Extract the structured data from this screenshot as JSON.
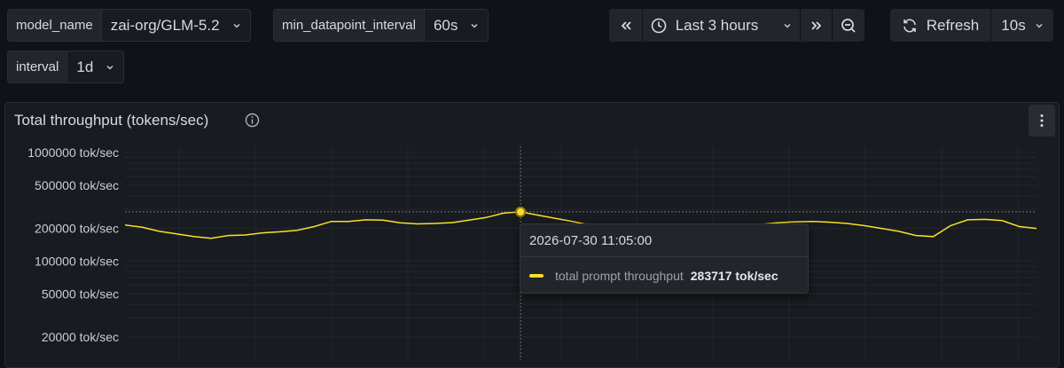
{
  "variables": {
    "model_name": {
      "label": "model_name",
      "value": "zai-org/GLM-5.2"
    },
    "min_datapoint_interval": {
      "label": "min_datapoint_interval",
      "value": "60s"
    },
    "interval": {
      "label": "interval",
      "value": "1d"
    }
  },
  "time_controls": {
    "range": "Last 3 hours",
    "refresh_label": "Refresh",
    "refresh_interval": "10s"
  },
  "panel": {
    "title": "Total throughput (tokens/sec)"
  },
  "tooltip": {
    "time": "2026-07-30 11:05:00",
    "series_name": "total prompt throughput",
    "value": "283717 tok/sec"
  },
  "colors": {
    "series": "#fade2a",
    "background": "#111217",
    "panel": "#181b1f"
  },
  "chart_data": {
    "type": "line",
    "scale": "log",
    "y_ticks": [
      {
        "value": 1000000,
        "label": "1000000 tok/sec"
      },
      {
        "value": 500000,
        "label": "500000 tok/sec"
      },
      {
        "value": 200000,
        "label": "200000 tok/sec"
      },
      {
        "value": 100000,
        "label": "100000 tok/sec"
      },
      {
        "value": 50000,
        "label": "50000 tok/sec"
      },
      {
        "value": 20000,
        "label": "20000 tok/sec"
      }
    ],
    "series": [
      {
        "name": "total prompt throughput",
        "values": [
          215000,
          205000,
          188000,
          178000,
          168000,
          162000,
          172000,
          174000,
          182000,
          186000,
          192000,
          208000,
          232000,
          232000,
          240000,
          238000,
          225000,
          220000,
          222000,
          226000,
          238000,
          252000,
          276000,
          284000,
          265000,
          248000,
          232000,
          215000,
          212000,
          210000,
          208000,
          206000,
          205000,
          208000,
          210000,
          212000,
          214000,
          218000,
          226000,
          230000,
          232000,
          228000,
          222000,
          212000,
          200000,
          188000,
          172000,
          168000,
          212000,
          240000,
          242000,
          236000,
          208000,
          200000
        ]
      }
    ]
  }
}
